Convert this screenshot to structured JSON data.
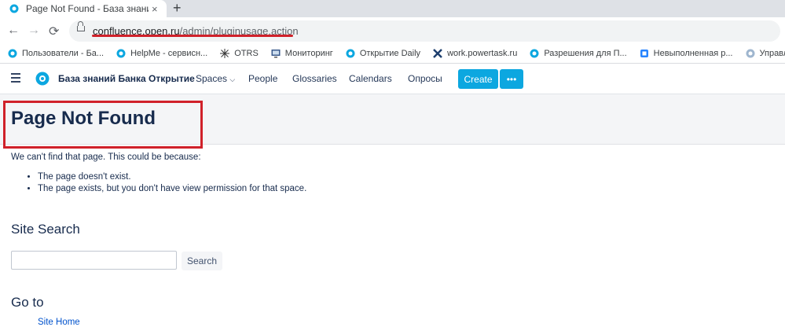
{
  "browser": {
    "tab_title": "Page Not Found - База знаний Б",
    "tab_close": "×",
    "new_tab": "+",
    "url_host": "confluence.open.ru",
    "url_path": "/admin/pluginusage.action"
  },
  "bookmarks": [
    {
      "label": "Пользователи - Ба...",
      "icon": "confluence-icon"
    },
    {
      "label": "HelpMe - сервисн...",
      "icon": "confluence-icon"
    },
    {
      "label": "OTRS",
      "icon": "otrs-icon"
    },
    {
      "label": "Мониторинг",
      "icon": "monitor-icon"
    },
    {
      "label": "Открытие Daily",
      "icon": "confluence-icon"
    },
    {
      "label": "work.powertask.ru",
      "icon": "powertask-icon"
    },
    {
      "label": "Разрешения для П...",
      "icon": "confluence-icon"
    },
    {
      "label": "Невыполненная р...",
      "icon": "jira-icon"
    },
    {
      "label": "Управлен",
      "icon": "confluence-icon"
    }
  ],
  "header": {
    "site_name": "База знаний Банка Открытие",
    "nav": [
      "Spaces",
      "People",
      "Glossaries",
      "Calendars",
      "Опросы"
    ],
    "create_label": "Create",
    "more_label": "•••"
  },
  "page": {
    "title": "Page Not Found",
    "intro": "We can't find that page. This could be because:",
    "reasons": [
      "The page doesn't exist.",
      "The page exists, but you don't have view permission for that space."
    ],
    "site_search_heading": "Site Search",
    "search_placeholder": "",
    "search_button": "Search",
    "goto_heading": "Go to",
    "goto_link": "Site Home"
  },
  "colors": {
    "accent": "#0ca7e0",
    "annotation_red": "#d0212a"
  }
}
